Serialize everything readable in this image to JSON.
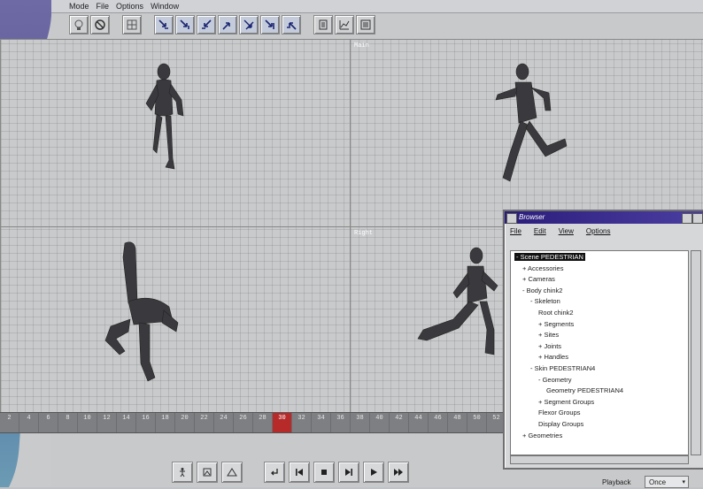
{
  "menubar": {
    "items": [
      "Mode",
      "File",
      "Options",
      "Window"
    ]
  },
  "viewports": [
    {
      "label": ""
    },
    {
      "label": "Main"
    },
    {
      "label": ""
    },
    {
      "label": "Right"
    }
  ],
  "timeline": {
    "frames": [
      "2",
      "4",
      "6",
      "8",
      "10",
      "12",
      "14",
      "16",
      "18",
      "20",
      "22",
      "24",
      "26",
      "28",
      "30",
      "32",
      "34",
      "36",
      "38",
      "40",
      "42",
      "44",
      "46",
      "48",
      "50",
      "52"
    ],
    "current": "30"
  },
  "playback": {
    "label": "Playback",
    "value": "Once"
  },
  "browser": {
    "title": "Browser",
    "menu": [
      "File",
      "Edit",
      "View",
      "Options"
    ],
    "tree": [
      {
        "text": "- Scene PEDESTRIAN",
        "depth": 0,
        "selected": true
      },
      {
        "text": "+ Accessories",
        "depth": 1
      },
      {
        "text": "+ Cameras",
        "depth": 1
      },
      {
        "text": "- Body chink2",
        "depth": 1
      },
      {
        "text": "- Skeleton",
        "depth": 2
      },
      {
        "text": "Root chink2",
        "depth": 3
      },
      {
        "text": "+ Segments",
        "depth": 3
      },
      {
        "text": "+ Sites",
        "depth": 3
      },
      {
        "text": "+ Joints",
        "depth": 3
      },
      {
        "text": "+ Handles",
        "depth": 3
      },
      {
        "text": "- Skin PEDESTRIAN4",
        "depth": 2
      },
      {
        "text": "- Geometry",
        "depth": 3
      },
      {
        "text": "Geometry PEDESTRIAN4",
        "depth": 4
      },
      {
        "text": "+ Segment Groups",
        "depth": 3
      },
      {
        "text": "Flexor Groups",
        "depth": 3
      },
      {
        "text": "Display Groups",
        "depth": 3
      },
      {
        "text": "+ Geometries",
        "depth": 1
      }
    ]
  }
}
